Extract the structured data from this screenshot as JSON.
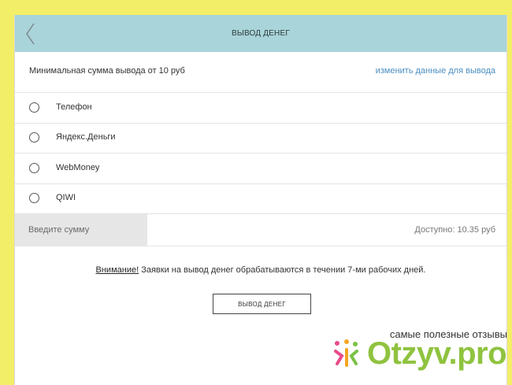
{
  "header": {
    "title": "ВЫВОД ДЕНЕГ",
    "back_icon": "chevron-left-icon"
  },
  "info": {
    "min_sum": "Минимальная сумма вывода от 10 руб",
    "change_link": "изменить данные для вывода"
  },
  "options": [
    {
      "label": "Телефон",
      "selected": false
    },
    {
      "label": "Яндекс.Деньги",
      "selected": false
    },
    {
      "label": "WebMoney",
      "selected": false
    },
    {
      "label": "QIWI",
      "selected": false
    }
  ],
  "amount": {
    "placeholder": "Введите сумму",
    "value": "",
    "available": "Доступно: 10.35 руб"
  },
  "notice": {
    "link": "Внимание!",
    "text": " Заявки на вывод денег обрабатываются в течении 7-ми рабочих дней."
  },
  "submit_label": "ВЫВОД ДЕНЕГ",
  "watermark": {
    "tagline": "самые полезные отзывы",
    "brand": "Otzyv.pro"
  },
  "colors": {
    "page_bg": "#f3ee68",
    "header_bg": "#a9d4d9",
    "link": "#4a8ec1",
    "brand": "#8fc33f"
  }
}
